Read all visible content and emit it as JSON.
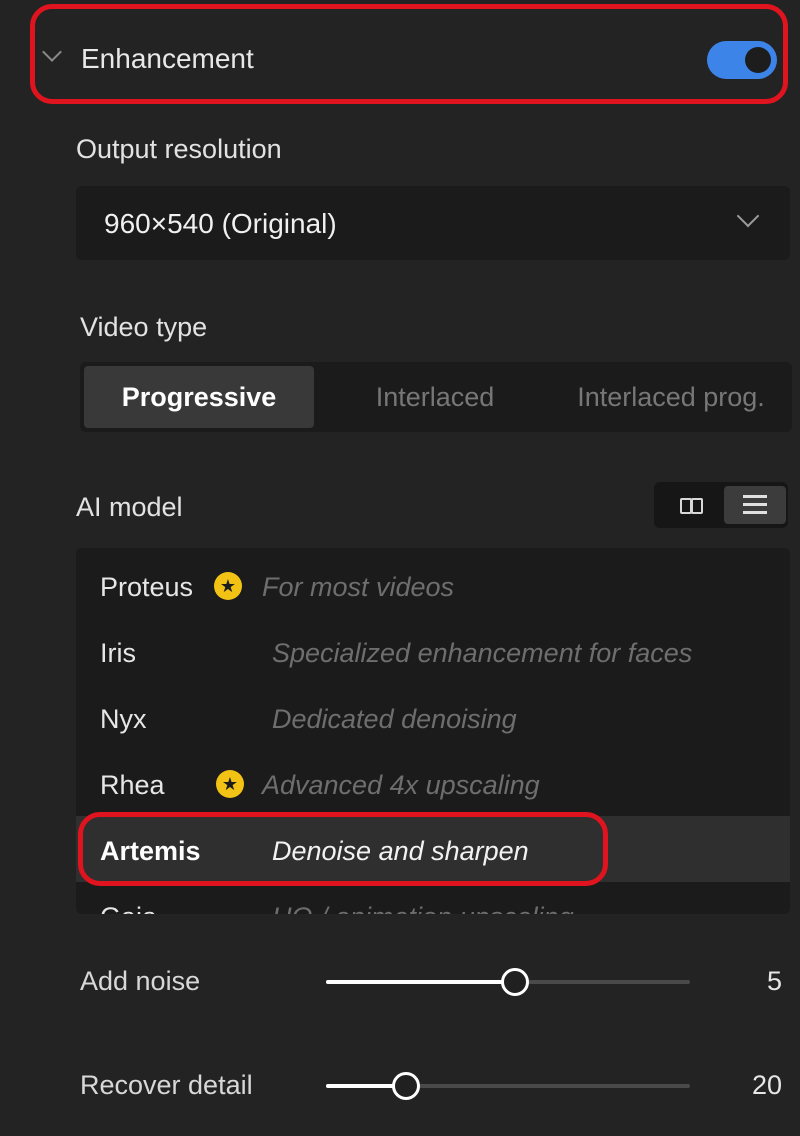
{
  "enhancement": {
    "title": "Enhancement",
    "enabled": true,
    "accent_color": "#3d84e8",
    "highlight_color": "#e0141e"
  },
  "output_resolution": {
    "label": "Output resolution",
    "value": "960×540 (Original)"
  },
  "video_type": {
    "label": "Video type",
    "options": [
      "Progressive",
      "Interlaced",
      "Interlaced prog."
    ],
    "selected": "Progressive"
  },
  "ai_model": {
    "label": "AI model",
    "view_modes": [
      "grid-view",
      "list-view"
    ],
    "active_view": "list-view",
    "models": [
      {
        "name": "Proteus",
        "description": "For most videos",
        "starred": true
      },
      {
        "name": "Iris",
        "description": "Specialized enhancement for faces",
        "starred": false
      },
      {
        "name": "Nyx",
        "description": "Dedicated denoising",
        "starred": false
      },
      {
        "name": "Rhea",
        "description": "Advanced 4x upscaling",
        "starred": true
      },
      {
        "name": "Artemis",
        "description": "Denoise and sharpen",
        "starred": false,
        "selected": true
      },
      {
        "name": "Gaia",
        "description": "HQ / animation upscaling",
        "starred": false
      }
    ]
  },
  "sliders": {
    "add_noise": {
      "label": "Add noise",
      "value": "5",
      "fraction": 0.52
    },
    "recover_detail": {
      "label": "Recover detail",
      "value": "20",
      "fraction": 0.22
    }
  }
}
